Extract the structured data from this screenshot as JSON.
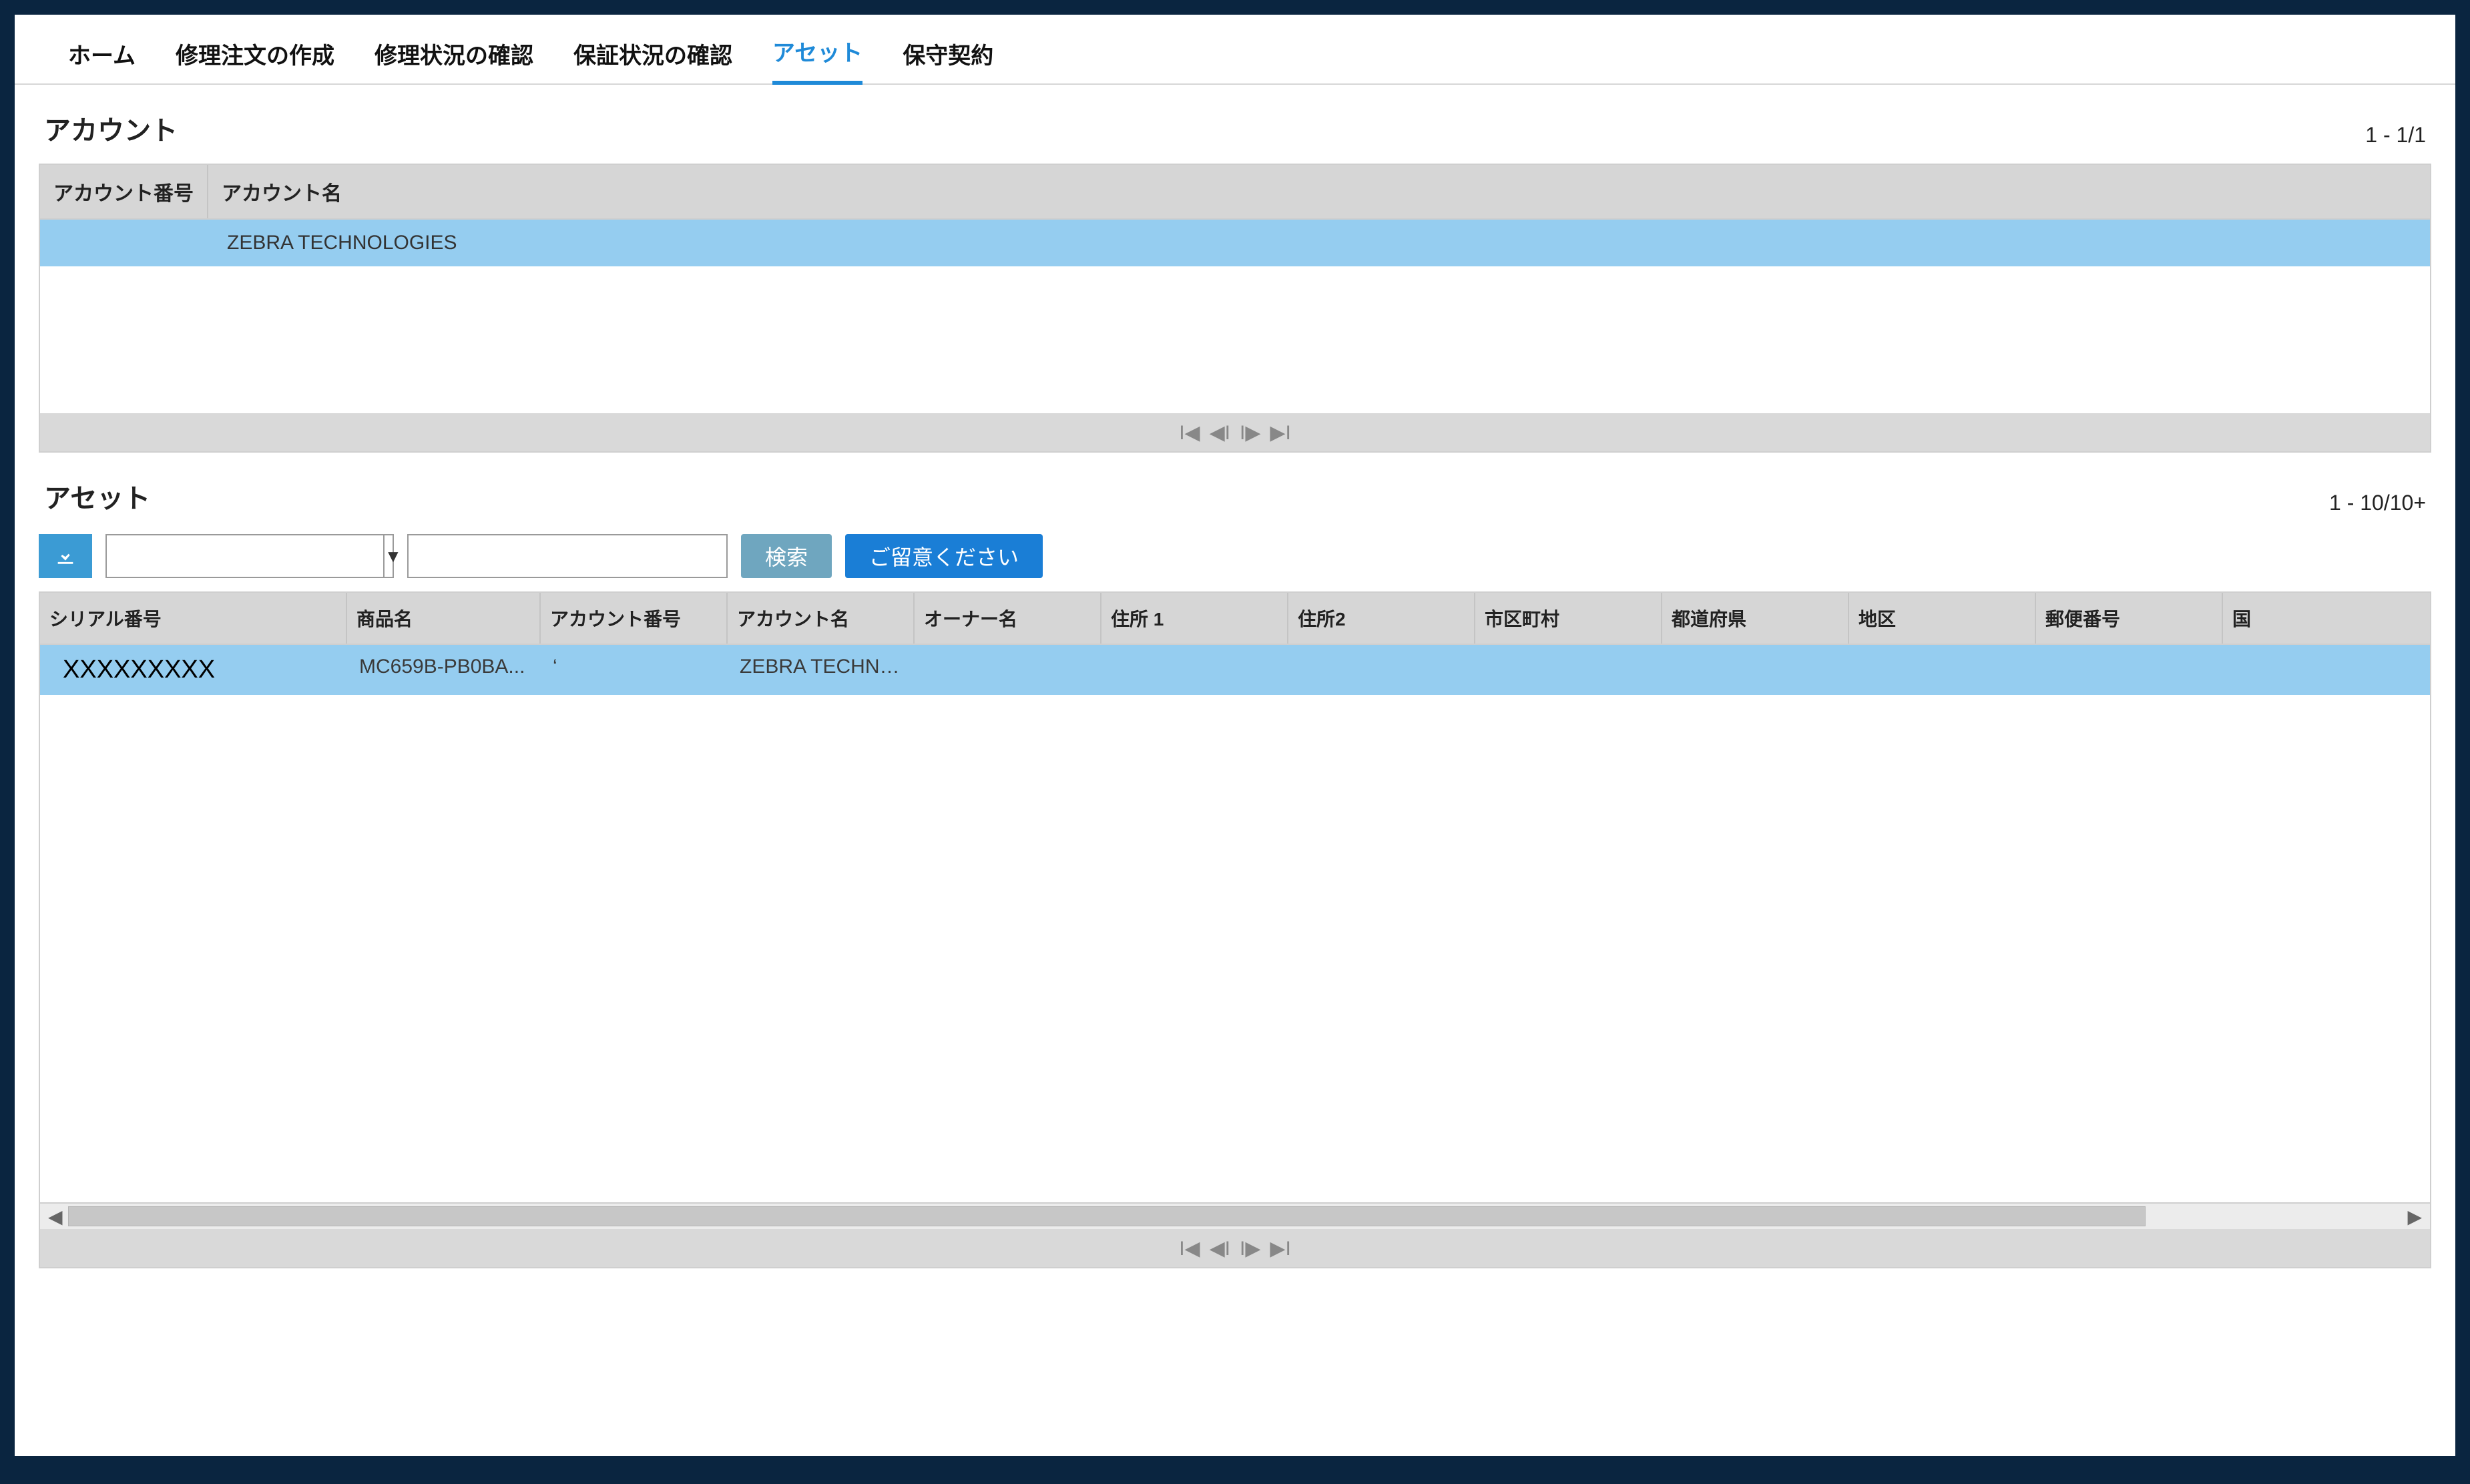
{
  "tabs": {
    "items": [
      {
        "label": "ホーム",
        "active": false
      },
      {
        "label": "修理注文の作成",
        "active": false
      },
      {
        "label": "修理状況の確認",
        "active": false
      },
      {
        "label": "保証状況の確認",
        "active": false
      },
      {
        "label": "アセット",
        "active": true
      },
      {
        "label": "保守契約",
        "active": false
      }
    ]
  },
  "account_section": {
    "title": "アカウント",
    "pager": "1 - 1/1",
    "columns": {
      "account_no": "アカウント番号",
      "account_name": "アカウント名"
    },
    "col_widths": {
      "account_no": "260px"
    },
    "rows": [
      {
        "account_no": "",
        "account_name": "ZEBRA TECHNOLOGIES"
      }
    ]
  },
  "asset_section": {
    "title": "アセット",
    "pager": "1 - 10/10+",
    "toolbar": {
      "search_label": "検索",
      "notice_label": "ご留意ください",
      "combo_value": "",
      "text_value": ""
    },
    "columns": [
      "シリアル番号",
      "商品名",
      "アカウント番号",
      "アカウント名",
      "オーナー名",
      "住所 1",
      "住所2",
      "市区町村",
      "都道府県",
      "地区",
      "郵便番号",
      "国"
    ],
    "rows": [
      {
        "serial": "XXXXXXXXX",
        "product": "MC659B-PB0BA...",
        "account_no": "‘",
        "account_name": "ZEBRA TECHNO...",
        "owner": "",
        "addr1": "",
        "addr2": "",
        "city": "",
        "pref": "",
        "district": "",
        "postal": "",
        "country": ""
      }
    ]
  },
  "icons": {
    "download": "download-icon",
    "caret_down": "▼",
    "pager_first": "⏮",
    "pager_prev": "◀◀",
    "pager_next": "▶▶",
    "pager_last": "⏭",
    "scroll_left": "◀",
    "scroll_right": "▶"
  },
  "colors": {
    "accent": "#1f8ad8",
    "row_highlight": "#95cdf0",
    "frame_bg": "#0a2540",
    "header_grey": "#d6d6d6"
  }
}
